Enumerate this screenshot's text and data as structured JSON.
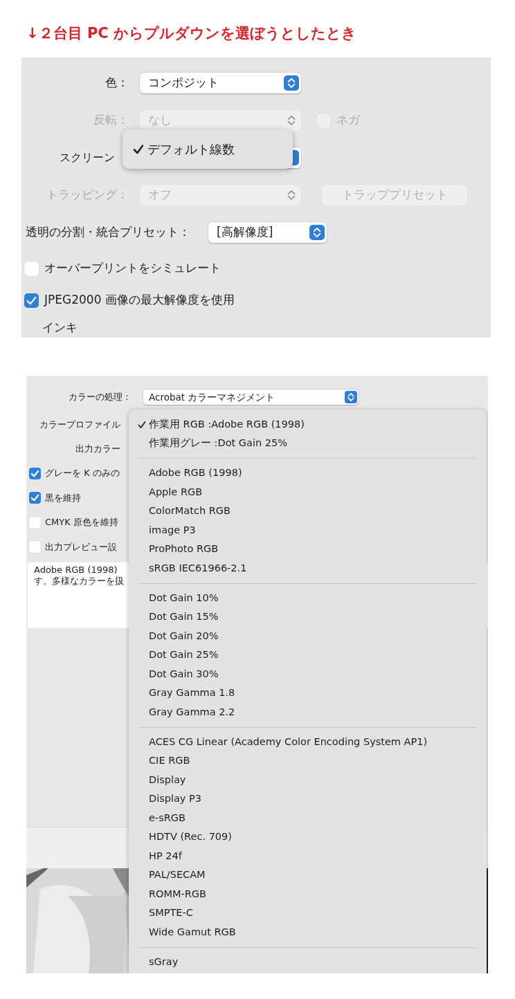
{
  "heading": "↓２台目 PC からプルダウンを選ぼうとしたとき",
  "print_panel": {
    "rows": [
      {
        "kind": "select",
        "label": "色：",
        "value": "コンポジット",
        "disabled": false
      },
      {
        "kind": "select",
        "label": "反転：",
        "value": "なし",
        "disabled": true,
        "checkbox": {
          "label": "ネガ",
          "checked": false,
          "disabled": true
        }
      },
      {
        "kind": "select",
        "label": "スクリーン",
        "disabled": false,
        "popup": [
          {
            "label": "デフォルト線数",
            "selected": true
          }
        ]
      },
      {
        "kind": "select",
        "label": "トラッピング：",
        "value": "オフ",
        "disabled": true,
        "button": {
          "label": "トラッププリセット",
          "disabled": true
        }
      },
      {
        "kind": "wide_select",
        "label": "透明の分割・統合プリセット：",
        "value": "[高解像度]",
        "disabled": false
      },
      {
        "kind": "checkbox",
        "label": "オーバープリントをシミュレート",
        "checked": false
      },
      {
        "kind": "checkbox",
        "label": "JPEG2000 画像の最大解像度を使用",
        "checked": true
      },
      {
        "kind": "section",
        "label": "インキ"
      }
    ]
  },
  "color_panel": {
    "rows": [
      {
        "kind": "select",
        "label": "カラーの処理：",
        "value": "Acrobat カラーマネジメント"
      },
      {
        "kind": "label",
        "label": "カラープロファイル"
      },
      {
        "kind": "label",
        "label": "出力カラー"
      },
      {
        "kind": "checkbox",
        "label": "グレーを K のみの",
        "checked": true
      },
      {
        "kind": "checkbox",
        "label": "黒を維持",
        "checked": true
      },
      {
        "kind": "checkbox",
        "label": "CMYK 原色を維持",
        "checked": false
      },
      {
        "kind": "checkbox",
        "label": "出力プレビュー設",
        "checked": false
      }
    ],
    "description": [
      "Adobe RGB (1998)",
      "す。多様なカラーを扱"
    ],
    "menu": [
      [
        {
          "label": "作業用 RGB :Adobe RGB (1998)",
          "selected": true
        },
        {
          "label": "作業用グレー :Dot Gain 25%",
          "selected": false
        }
      ],
      [
        {
          "label": "Adobe RGB (1998)",
          "selected": false
        },
        {
          "label": "Apple RGB",
          "selected": false
        },
        {
          "label": "ColorMatch RGB",
          "selected": false
        },
        {
          "label": "image P3",
          "selected": false
        },
        {
          "label": "ProPhoto RGB",
          "selected": false
        },
        {
          "label": "sRGB IEC61966-2.1",
          "selected": false
        }
      ],
      [
        {
          "label": "Dot Gain 10%",
          "selected": false
        },
        {
          "label": "Dot Gain 15%",
          "selected": false
        },
        {
          "label": "Dot Gain 20%",
          "selected": false
        },
        {
          "label": "Dot Gain 25%",
          "selected": false
        },
        {
          "label": "Dot Gain 30%",
          "selected": false
        },
        {
          "label": "Gray Gamma 1.8",
          "selected": false
        },
        {
          "label": "Gray Gamma 2.2",
          "selected": false
        }
      ],
      [
        {
          "label": "ACES CG Linear (Academy Color Encoding System AP1)",
          "selected": false
        },
        {
          "label": "CIE RGB",
          "selected": false
        },
        {
          "label": "Display",
          "selected": false
        },
        {
          "label": "Display P3",
          "selected": false
        },
        {
          "label": "e-sRGB",
          "selected": false
        },
        {
          "label": "HDTV (Rec. 709)",
          "selected": false
        },
        {
          "label": "HP 24f",
          "selected": false
        },
        {
          "label": "PAL/SECAM",
          "selected": false
        },
        {
          "label": "ROMM-RGB",
          "selected": false
        },
        {
          "label": "SMPTE-C",
          "selected": false
        },
        {
          "label": "Wide Gamut RGB",
          "selected": false
        }
      ],
      [
        {
          "label": "sGray",
          "selected": false
        }
      ]
    ]
  }
}
